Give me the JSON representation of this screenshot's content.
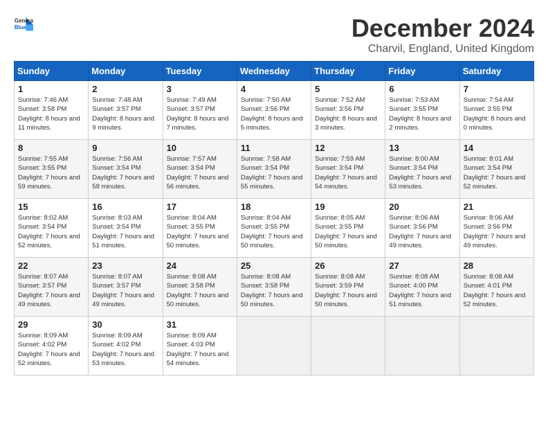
{
  "header": {
    "logo_line1": "General",
    "logo_line2": "Blue",
    "month": "December 2024",
    "location": "Charvil, England, United Kingdom"
  },
  "weekdays": [
    "Sunday",
    "Monday",
    "Tuesday",
    "Wednesday",
    "Thursday",
    "Friday",
    "Saturday"
  ],
  "weeks": [
    [
      {
        "day": "1",
        "sunrise": "Sunrise: 7:46 AM",
        "sunset": "Sunset: 3:58 PM",
        "daylight": "Daylight: 8 hours and 11 minutes."
      },
      {
        "day": "2",
        "sunrise": "Sunrise: 7:48 AM",
        "sunset": "Sunset: 3:57 PM",
        "daylight": "Daylight: 8 hours and 9 minutes."
      },
      {
        "day": "3",
        "sunrise": "Sunrise: 7:49 AM",
        "sunset": "Sunset: 3:57 PM",
        "daylight": "Daylight: 8 hours and 7 minutes."
      },
      {
        "day": "4",
        "sunrise": "Sunrise: 7:50 AM",
        "sunset": "Sunset: 3:56 PM",
        "daylight": "Daylight: 8 hours and 5 minutes."
      },
      {
        "day": "5",
        "sunrise": "Sunrise: 7:52 AM",
        "sunset": "Sunset: 3:56 PM",
        "daylight": "Daylight: 8 hours and 3 minutes."
      },
      {
        "day": "6",
        "sunrise": "Sunrise: 7:53 AM",
        "sunset": "Sunset: 3:55 PM",
        "daylight": "Daylight: 8 hours and 2 minutes."
      },
      {
        "day": "7",
        "sunrise": "Sunrise: 7:54 AM",
        "sunset": "Sunset: 3:55 PM",
        "daylight": "Daylight: 8 hours and 0 minutes."
      }
    ],
    [
      {
        "day": "8",
        "sunrise": "Sunrise: 7:55 AM",
        "sunset": "Sunset: 3:55 PM",
        "daylight": "Daylight: 7 hours and 59 minutes."
      },
      {
        "day": "9",
        "sunrise": "Sunrise: 7:56 AM",
        "sunset": "Sunset: 3:54 PM",
        "daylight": "Daylight: 7 hours and 58 minutes."
      },
      {
        "day": "10",
        "sunrise": "Sunrise: 7:57 AM",
        "sunset": "Sunset: 3:54 PM",
        "daylight": "Daylight: 7 hours and 56 minutes."
      },
      {
        "day": "11",
        "sunrise": "Sunrise: 7:58 AM",
        "sunset": "Sunset: 3:54 PM",
        "daylight": "Daylight: 7 hours and 55 minutes."
      },
      {
        "day": "12",
        "sunrise": "Sunrise: 7:59 AM",
        "sunset": "Sunset: 3:54 PM",
        "daylight": "Daylight: 7 hours and 54 minutes."
      },
      {
        "day": "13",
        "sunrise": "Sunrise: 8:00 AM",
        "sunset": "Sunset: 3:54 PM",
        "daylight": "Daylight: 7 hours and 53 minutes."
      },
      {
        "day": "14",
        "sunrise": "Sunrise: 8:01 AM",
        "sunset": "Sunset: 3:54 PM",
        "daylight": "Daylight: 7 hours and 52 minutes."
      }
    ],
    [
      {
        "day": "15",
        "sunrise": "Sunrise: 8:02 AM",
        "sunset": "Sunset: 3:54 PM",
        "daylight": "Daylight: 7 hours and 52 minutes."
      },
      {
        "day": "16",
        "sunrise": "Sunrise: 8:03 AM",
        "sunset": "Sunset: 3:54 PM",
        "daylight": "Daylight: 7 hours and 51 minutes."
      },
      {
        "day": "17",
        "sunrise": "Sunrise: 8:04 AM",
        "sunset": "Sunset: 3:55 PM",
        "daylight": "Daylight: 7 hours and 50 minutes."
      },
      {
        "day": "18",
        "sunrise": "Sunrise: 8:04 AM",
        "sunset": "Sunset: 3:55 PM",
        "daylight": "Daylight: 7 hours and 50 minutes."
      },
      {
        "day": "19",
        "sunrise": "Sunrise: 8:05 AM",
        "sunset": "Sunset: 3:55 PM",
        "daylight": "Daylight: 7 hours and 50 minutes."
      },
      {
        "day": "20",
        "sunrise": "Sunrise: 8:06 AM",
        "sunset": "Sunset: 3:56 PM",
        "daylight": "Daylight: 7 hours and 49 minutes."
      },
      {
        "day": "21",
        "sunrise": "Sunrise: 8:06 AM",
        "sunset": "Sunset: 3:56 PM",
        "daylight": "Daylight: 7 hours and 49 minutes."
      }
    ],
    [
      {
        "day": "22",
        "sunrise": "Sunrise: 8:07 AM",
        "sunset": "Sunset: 3:57 PM",
        "daylight": "Daylight: 7 hours and 49 minutes."
      },
      {
        "day": "23",
        "sunrise": "Sunrise: 8:07 AM",
        "sunset": "Sunset: 3:57 PM",
        "daylight": "Daylight: 7 hours and 49 minutes."
      },
      {
        "day": "24",
        "sunrise": "Sunrise: 8:08 AM",
        "sunset": "Sunset: 3:58 PM",
        "daylight": "Daylight: 7 hours and 50 minutes."
      },
      {
        "day": "25",
        "sunrise": "Sunrise: 8:08 AM",
        "sunset": "Sunset: 3:58 PM",
        "daylight": "Daylight: 7 hours and 50 minutes."
      },
      {
        "day": "26",
        "sunrise": "Sunrise: 8:08 AM",
        "sunset": "Sunset: 3:59 PM",
        "daylight": "Daylight: 7 hours and 50 minutes."
      },
      {
        "day": "27",
        "sunrise": "Sunrise: 8:08 AM",
        "sunset": "Sunset: 4:00 PM",
        "daylight": "Daylight: 7 hours and 51 minutes."
      },
      {
        "day": "28",
        "sunrise": "Sunrise: 8:08 AM",
        "sunset": "Sunset: 4:01 PM",
        "daylight": "Daylight: 7 hours and 52 minutes."
      }
    ],
    [
      {
        "day": "29",
        "sunrise": "Sunrise: 8:09 AM",
        "sunset": "Sunset: 4:02 PM",
        "daylight": "Daylight: 7 hours and 52 minutes."
      },
      {
        "day": "30",
        "sunrise": "Sunrise: 8:09 AM",
        "sunset": "Sunset: 4:02 PM",
        "daylight": "Daylight: 7 hours and 53 minutes."
      },
      {
        "day": "31",
        "sunrise": "Sunrise: 8:09 AM",
        "sunset": "Sunset: 4:03 PM",
        "daylight": "Daylight: 7 hours and 54 minutes."
      },
      null,
      null,
      null,
      null
    ]
  ]
}
